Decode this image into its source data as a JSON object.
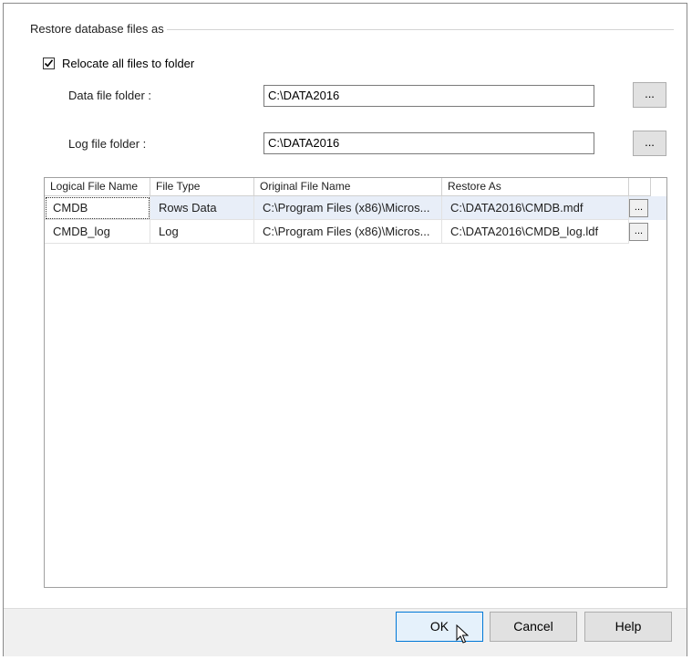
{
  "section": {
    "title": "Restore database files as"
  },
  "relocate": {
    "label": "Relocate all files to folder",
    "checked": true
  },
  "data_folder": {
    "label": "Data file folder :",
    "value": "C:\\DATA2016",
    "browse_label": "..."
  },
  "log_folder": {
    "label": "Log file folder :",
    "value": "C:\\DATA2016",
    "browse_label": "..."
  },
  "grid": {
    "columns": [
      "Logical File Name",
      "File Type",
      "Original File Name",
      "Restore As"
    ],
    "rows": [
      {
        "logical": "CMDB",
        "type": "Rows Data",
        "original": "C:\\Program Files (x86)\\Micros...",
        "restore": "C:\\DATA2016\\CMDB.mdf",
        "btn": "..."
      },
      {
        "logical": "CMDB_log",
        "type": "Log",
        "original": "C:\\Program Files (x86)\\Micros...",
        "restore": "C:\\DATA2016\\CMDB_log.ldf",
        "btn": "..."
      }
    ]
  },
  "buttons": {
    "ok": "OK",
    "cancel": "Cancel",
    "help": "Help"
  },
  "colors": {
    "accent": "#0078d7",
    "selected_row": "#e8eef8",
    "footer": "#f0f0f0"
  }
}
